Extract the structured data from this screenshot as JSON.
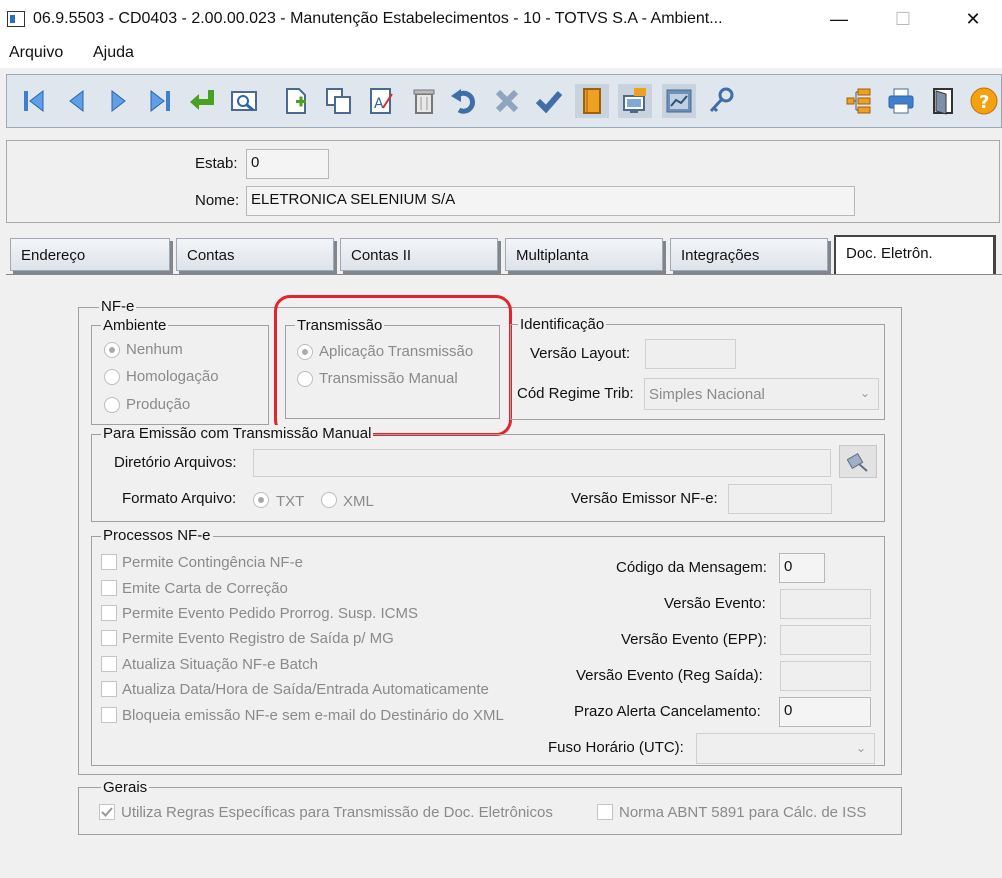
{
  "window": {
    "title": "06.9.5503 - CD0403 - 2.00.00.023 - Manutenção Estabelecimentos - 10 - TOTVS S.A - Ambient...",
    "minimize": "—",
    "maximize": "☐",
    "close": "✕"
  },
  "menu": [
    "Arquivo",
    "Ajuda"
  ],
  "toolbar": {
    "icons": [
      "first-icon",
      "prev-icon",
      "next-icon",
      "last-icon",
      "goto-icon",
      "search-icon",
      "add-icon",
      "copy-icon",
      "edit-icon",
      "delete-icon",
      "undo-icon",
      "cancel-icon",
      "save-icon",
      "book-icon",
      "monitor-icon",
      "report-icon",
      "key-icon",
      "tree-icon",
      "print-icon",
      "exit-icon",
      "help-icon"
    ]
  },
  "header": {
    "estab_label": "Estab:",
    "estab_value": "0",
    "nome_label": "Nome:",
    "nome_value": "ELETRONICA SELENIUM S/A"
  },
  "tabs": [
    "Endereço",
    "Contas",
    "Contas II",
    "Multiplanta",
    "Integrações",
    "Doc. Eletrôn."
  ],
  "active_tab": "Doc. Eletrôn.",
  "nfe": {
    "title": "NF-e",
    "ambiente": {
      "title": "Ambiente",
      "options": [
        "Nenhum",
        "Homologação",
        "Produção"
      ],
      "selected": "Nenhum"
    },
    "transmissao": {
      "title": "Transmissão",
      "options": [
        "Aplicação Transmissão",
        "Transmissão Manual"
      ],
      "selected": "Aplicação Transmissão"
    },
    "identificacao": {
      "title": "Identificação",
      "versao_layout_label": "Versão Layout:",
      "versao_layout_value": "",
      "regime_label": "Cód Regime Trib:",
      "regime_value": "Simples Nacional"
    },
    "manual": {
      "title": "Para Emissão com Transmissão Manual",
      "diretorio_label": "Diretório Arquivos:",
      "diretorio_value": "",
      "formato_label": "Formato Arquivo:",
      "formato_options": [
        "TXT",
        "XML"
      ],
      "formato_selected": "TXT",
      "versao_emissor_label": "Versão Emissor NF-e:",
      "versao_emissor_value": ""
    },
    "processos": {
      "title": "Processos NF-e",
      "checks": [
        "Permite Contingência NF-e",
        "Emite Carta de Correção",
        "Permite Evento Pedido Prorrog. Susp. ICMS",
        "Permite Evento Registro de Saída p/ MG",
        "Atualiza Situação NF-e Batch",
        "Atualiza Data/Hora de Saída/Entrada Automaticamente",
        "Bloqueia emissão NF-e sem e-mail do Destinário do XML"
      ],
      "codigo_msg_label": "Código da Mensagem:",
      "codigo_msg_value": "0",
      "versao_evento_label": "Versão Evento:",
      "versao_evento_value": "",
      "versao_evento_epp_label": "Versão Evento (EPP):",
      "versao_evento_epp_value": "",
      "versao_evento_saida_label": "Versão Evento (Reg Saída):",
      "versao_evento_saida_value": "",
      "prazo_label": "Prazo Alerta Cancelamento:",
      "prazo_value": "0",
      "fuso_label": "Fuso Horário (UTC):",
      "fuso_value": ""
    }
  },
  "gerais": {
    "title": "Gerais",
    "regras_label": "Utiliza Regras Específicas para Transmissão de Doc. Eletrônicos",
    "regras_checked": true,
    "abnt_label": "Norma ABNT 5891 para Cálc. de ISS",
    "abnt_checked": false
  }
}
